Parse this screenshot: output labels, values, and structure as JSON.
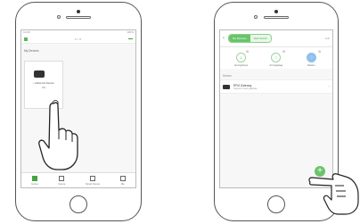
{
  "left_screen": {
    "status_time": "10:09",
    "status_right": "100%",
    "header_title": "• :: •",
    "section_label": "My Devices",
    "device": {
      "name": "• eWeLink Device",
      "sub": "ON"
    },
    "tabs": [
      {
        "label": "Home"
      },
      {
        "label": "Scene"
      },
      {
        "label": "Smart Scene"
      },
      {
        "label": "Me"
      }
    ]
  },
  "right_screen": {
    "back": "‹",
    "segments": [
      "My Devices",
      "Wall Switch"
    ],
    "edit_label": "Edit",
    "scenes": [
      {
        "label": "Arming/home",
        "icon": "shield-home-icon"
      },
      {
        "label": "Arming/away",
        "icon": "shield-away-icon"
      },
      {
        "label": "Disarm",
        "icon": "shield-disarm-icon"
      }
    ],
    "section_label": "Device",
    "device": {
      "name": "RFM Gateway",
      "sub": "Support smart gateway"
    },
    "fab": "+"
  },
  "colors": {
    "accent": "#6ac46a",
    "disarm": "#8fc0ee"
  }
}
